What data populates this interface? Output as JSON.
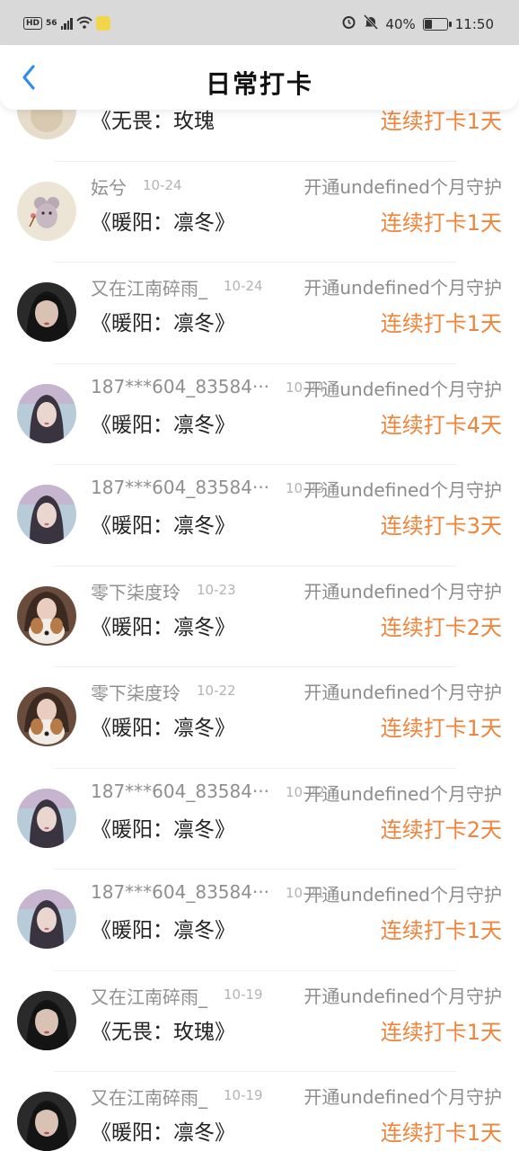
{
  "status_bar": {
    "hd": "HD",
    "network": "56",
    "battery_text": "40%",
    "battery_level": 0.4,
    "time": "11:50",
    "icons": [
      "signal-icon",
      "wifi-icon",
      "app-notification-icon",
      "alarm-icon",
      "mute-icon",
      "battery-icon"
    ]
  },
  "header": {
    "title": "日常打卡",
    "back_icon": "chevron-left-icon",
    "accent": "#2f8cf0"
  },
  "colors": {
    "streak": "#f0843a",
    "name": "#8f8f8f",
    "date": "#b3b3b3"
  },
  "items": [
    {
      "name": "",
      "date": "",
      "guard": "",
      "work": "《无畏：玫瑰",
      "streak": "连续打卡1天",
      "avatar": "beige"
    },
    {
      "name": "妘兮",
      "date": "10-24",
      "guard": "开通undefined个月守护",
      "work": "《暖阳：凛冬》",
      "streak": "连续打卡1天",
      "avatar": "mouse"
    },
    {
      "name": "又在江南碎雨_",
      "date": "10-24",
      "guard": "开通undefined个月守护",
      "work": "《暖阳：凛冬》",
      "streak": "连续打卡1天",
      "avatar": "dark-girl"
    },
    {
      "name": "187***604_83584···",
      "date": "10-24",
      "guard": "开通undefined个月守护",
      "work": "《暖阳：凛冬》",
      "streak": "连续打卡4天",
      "avatar": "light-girl"
    },
    {
      "name": "187***604_83584···",
      "date": "10-23",
      "guard": "开通undefined个月守护",
      "work": "《暖阳：凛冬》",
      "streak": "连续打卡3天",
      "avatar": "light-girl"
    },
    {
      "name": "零下柒度玲",
      "date": "10-23",
      "guard": "开通undefined个月守护",
      "work": "《暖阳：凛冬》",
      "streak": "连续打卡2天",
      "avatar": "girl-dog"
    },
    {
      "name": "零下柒度玲",
      "date": "10-22",
      "guard": "开通undefined个月守护",
      "work": "《暖阳：凛冬》",
      "streak": "连续打卡1天",
      "avatar": "girl-dog"
    },
    {
      "name": "187***604_83584···",
      "date": "10-22",
      "guard": "开通undefined个月守护",
      "work": "《暖阳：凛冬》",
      "streak": "连续打卡2天",
      "avatar": "light-girl"
    },
    {
      "name": "187***604_83584···",
      "date": "10-21",
      "guard": "开通undefined个月守护",
      "work": "《暖阳：凛冬》",
      "streak": "连续打卡1天",
      "avatar": "light-girl"
    },
    {
      "name": "又在江南碎雨_",
      "date": "10-19",
      "guard": "开通undefined个月守护",
      "work": "《无畏：玫瑰》",
      "streak": "连续打卡1天",
      "avatar": "dark-girl"
    },
    {
      "name": "又在江南碎雨_",
      "date": "10-19",
      "guard": "开通undefined个月守护",
      "work": "《暖阳：凛冬》",
      "streak": "连续打卡1天",
      "avatar": "dark-girl"
    }
  ]
}
